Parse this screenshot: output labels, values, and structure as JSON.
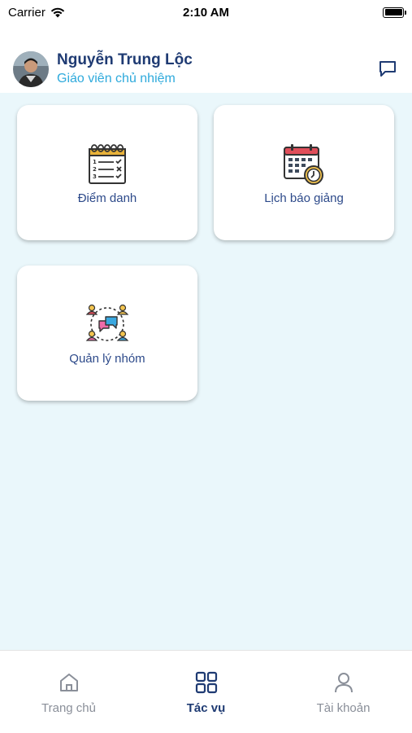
{
  "status_bar": {
    "carrier": "Carrier",
    "time": "2:10 AM"
  },
  "header": {
    "name": "Nguyễn Trung Lộc",
    "role": "Giáo viên chủ nhiệm"
  },
  "tasks": [
    {
      "label": "Điểm danh",
      "icon": "attendance-checklist-icon"
    },
    {
      "label": "Lịch báo giảng",
      "icon": "calendar-clock-icon"
    },
    {
      "label": "Quản lý nhóm",
      "icon": "group-chat-icon"
    }
  ],
  "tabs": [
    {
      "label": "Trang chủ",
      "icon": "home-icon",
      "active": false
    },
    {
      "label": "Tác vụ",
      "icon": "grid-icon",
      "active": true
    },
    {
      "label": "Tài khoản",
      "icon": "user-icon",
      "active": false
    }
  ],
  "colors": {
    "primary": "#1f3b73",
    "accent": "#2eaadc",
    "background": "#eaf7fb",
    "inactive": "#8a8f99"
  }
}
